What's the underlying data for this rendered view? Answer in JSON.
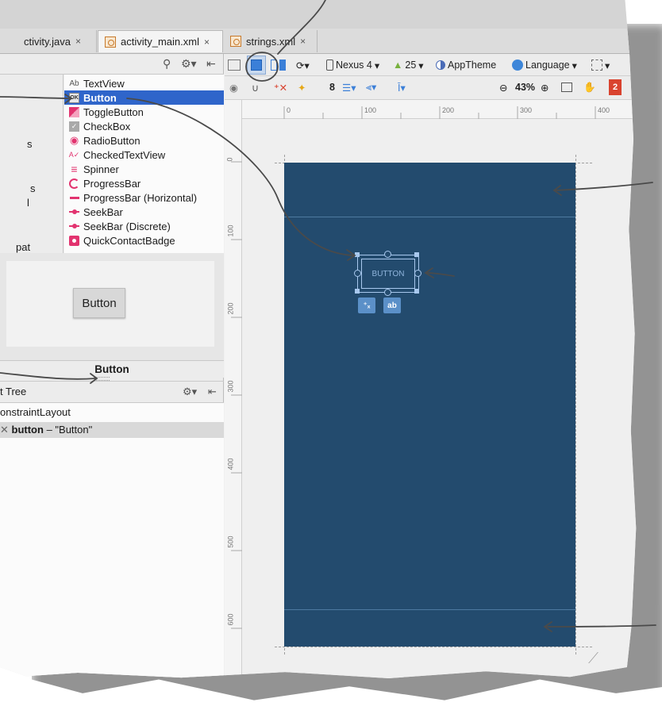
{
  "tabs": [
    {
      "label": "ctivity.java",
      "close": "×"
    },
    {
      "label": "activity_main.xml",
      "close": "×"
    },
    {
      "label": "strings.xml",
      "close": "×"
    }
  ],
  "palette": {
    "categories": [
      "s",
      "s",
      "l",
      "pat"
    ],
    "widgets": [
      {
        "icon": "Ab",
        "label": "TextView"
      },
      {
        "icon": "OK",
        "label": "Button"
      },
      {
        "icon": "",
        "label": "ToggleButton"
      },
      {
        "icon": "✓",
        "label": "CheckBox"
      },
      {
        "icon": "◉",
        "label": "RadioButton"
      },
      {
        "icon": "A✓",
        "label": "CheckedTextView"
      },
      {
        "icon": "≡",
        "label": "Spinner"
      },
      {
        "icon": "",
        "label": "ProgressBar"
      },
      {
        "icon": "",
        "label": "ProgressBar (Horizontal)"
      },
      {
        "icon": "",
        "label": "SeekBar"
      },
      {
        "icon": "",
        "label": "SeekBar (Discrete)"
      },
      {
        "icon": "",
        "label": "QuickContactBadge"
      }
    ],
    "preview_button_label": "Button",
    "preview_caption": "Button"
  },
  "component_tree": {
    "header": "t Tree",
    "root": "onstraintLayout",
    "child_name": "button",
    "child_text": " – \"Button\""
  },
  "toolbar": {
    "device": "Nexus 4",
    "api": "25",
    "theme": "AppTheme",
    "language": "Language",
    "margin": "8",
    "zoom": "43%",
    "error_count": "2"
  },
  "ruler": {
    "h_ticks": [
      "0",
      "100",
      "200",
      "300",
      "400"
    ],
    "v_ticks": [
      "0",
      "100",
      "200",
      "300",
      "400",
      "500",
      "600"
    ]
  },
  "design": {
    "button_label": "BUTTON",
    "mini1": "⁺ₓ",
    "mini2": "ab"
  },
  "colors": {
    "selection": "#2f65ca",
    "screen": "#234b6e",
    "error_badge": "#d9432f"
  }
}
